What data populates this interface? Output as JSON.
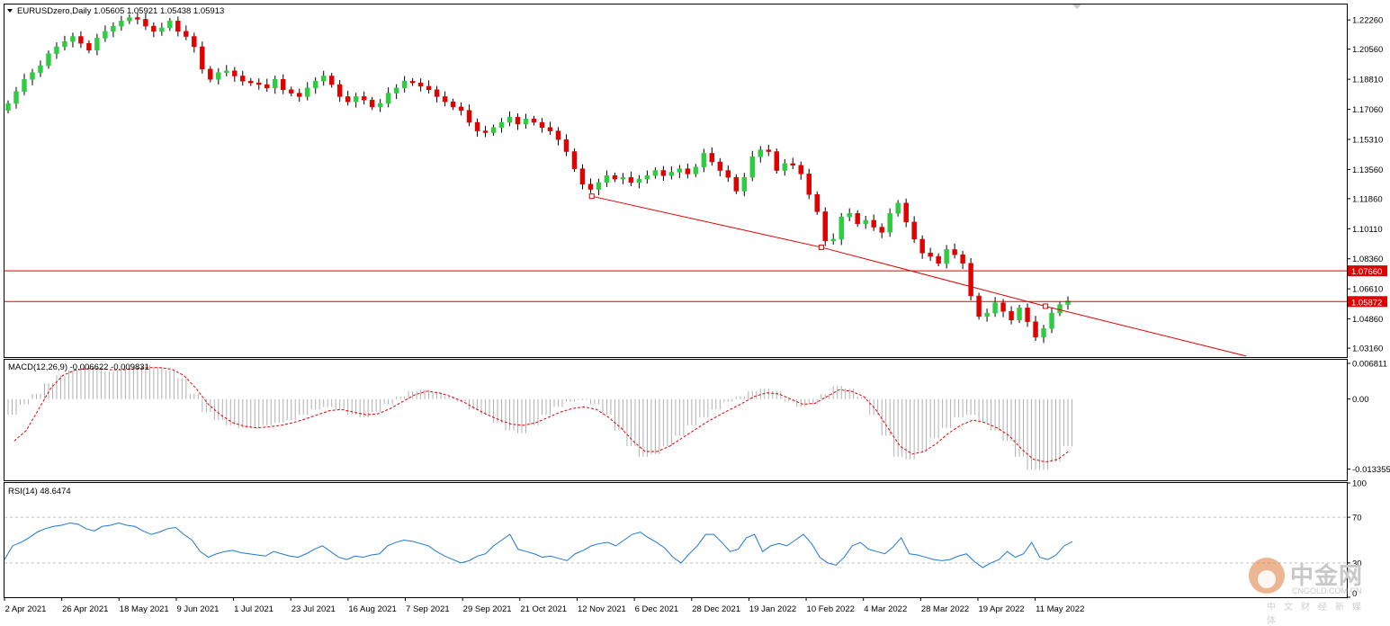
{
  "header": {
    "symbol_line": "EURUSDzero,Daily  1.05605 1.05921 1.05438 1.05913"
  },
  "colors": {
    "bull": "#2ecc40",
    "bear": "#e00000",
    "line": "#e00000",
    "rsi": "#1f77d0",
    "macd_hist": "#b0b0b0",
    "macd_signal": "#e00000",
    "grid": "#c0c0c0"
  },
  "chart_data": [
    {
      "type": "candlestick",
      "title": "EURUSDzero,Daily",
      "ohlc_label": "1.05605 1.05921 1.05438 1.05913",
      "ylim": [
        1.0264,
        1.2316
      ],
      "y_ticks": [
        "1.22260",
        "1.20560",
        "1.18810",
        "1.17060",
        "1.15310",
        "1.13560",
        "1.11860",
        "1.10110",
        "1.08360",
        "1.06610",
        "1.04860",
        "1.03160"
      ],
      "y_tick_values": [
        1.2226,
        1.2056,
        1.1881,
        1.1706,
        1.1531,
        1.1356,
        1.1186,
        1.1011,
        1.0836,
        1.0661,
        1.0486,
        1.0316
      ],
      "x_ticks": [
        "2 Apr 2021",
        "26 Apr 2021",
        "18 May 2021",
        "9 Jun 2021",
        "1 Jul 2021",
        "23 Jul 2021",
        "16 Aug 2021",
        "7 Sep 2021",
        "29 Sep 2021",
        "21 Oct 2021",
        "12 Nov 2021",
        "6 Dec 2021",
        "28 Dec 2021",
        "19 Jan 2022",
        "10 Feb 2022",
        "4 Mar 2022",
        "28 Mar 2022",
        "19 Apr 2022",
        "11 May 2022"
      ],
      "close_path": [
        1.174,
        1.181,
        1.188,
        1.192,
        1.196,
        1.203,
        1.207,
        1.21,
        1.213,
        1.209,
        1.205,
        1.212,
        1.216,
        1.219,
        1.222,
        1.224,
        1.223,
        1.219,
        1.216,
        1.218,
        1.222,
        1.216,
        1.213,
        1.207,
        1.194,
        1.188,
        1.192,
        1.193,
        1.19,
        1.187,
        1.186,
        1.185,
        1.183,
        1.188,
        1.182,
        1.18,
        1.178,
        1.183,
        1.187,
        1.19,
        1.185,
        1.178,
        1.175,
        1.178,
        1.176,
        1.172,
        1.174,
        1.18,
        1.183,
        1.187,
        1.186,
        1.184,
        1.182,
        1.178,
        1.175,
        1.172,
        1.17,
        1.163,
        1.158,
        1.157,
        1.16,
        1.163,
        1.166,
        1.162,
        1.165,
        1.163,
        1.16,
        1.158,
        1.153,
        1.146,
        1.136,
        1.127,
        1.124,
        1.128,
        1.132,
        1.13,
        1.131,
        1.128,
        1.13,
        1.132,
        1.135,
        1.132,
        1.134,
        1.136,
        1.133,
        1.137,
        1.145,
        1.14,
        1.135,
        1.131,
        1.123,
        1.131,
        1.143,
        1.147,
        1.146,
        1.135,
        1.139,
        1.138,
        1.133,
        1.121,
        1.111,
        1.094,
        1.095,
        1.108,
        1.11,
        1.104,
        1.106,
        1.102,
        1.099,
        1.11,
        1.116,
        1.105,
        1.095,
        1.087,
        1.085,
        1.081,
        1.089,
        1.086,
        1.081,
        1.062,
        1.05,
        1.052,
        1.058,
        1.053,
        1.048,
        1.055,
        1.047,
        1.038,
        1.043,
        1.052,
        1.057,
        1.0591
      ],
      "trendline": [
        [
          0.4375,
          1.12
        ],
        [
          0.6085,
          1.0903
        ],
        [
          0.7755,
          1.056
        ],
        [
          0.925,
          1.027
        ]
      ],
      "hlines": [
        {
          "value": 1.0766,
          "label": "1.07660"
        },
        {
          "value": 1.05872,
          "label": "1.05872"
        }
      ]
    },
    {
      "type": "bar",
      "title": "MACD(12,26,9) -0.006622 -0.009831",
      "ylim": [
        -0.0155,
        0.0075
      ],
      "y_ticks": [
        "0.006811",
        "0.00",
        "-0.013355"
      ],
      "y_tick_values": [
        0.006811,
        0.0,
        -0.013355
      ],
      "histogram": [
        -0.003,
        -0.001,
        0.001,
        0.003,
        0.0045,
        0.0055,
        0.006,
        0.0058,
        0.0052,
        0.0055,
        0.0062,
        0.0065,
        0.0062,
        0.0055,
        0.004,
        0.001,
        -0.0025,
        -0.004,
        -0.005,
        -0.0055,
        -0.0055,
        -0.005,
        -0.0045,
        -0.004,
        -0.003,
        -0.002,
        -0.0015,
        -0.002,
        -0.003,
        -0.0035,
        -0.0025,
        -0.001,
        0.0005,
        0.0015,
        0.0018,
        0.0012,
        0.0005,
        -0.0005,
        -0.002,
        -0.003,
        -0.0045,
        -0.006,
        -0.0065,
        -0.005,
        -0.003,
        -0.0015,
        -0.0005,
        -0.0002,
        -0.001,
        -0.003,
        -0.006,
        -0.009,
        -0.011,
        -0.0105,
        -0.009,
        -0.007,
        -0.005,
        -0.0035,
        -0.002,
        -0.0005,
        0.0005,
        0.0015,
        0.002,
        0.0015,
        -0.0005,
        -0.0015,
        -0.001,
        0.001,
        0.0025,
        0.002,
        0.0005,
        -0.003,
        -0.007,
        -0.011,
        -0.0115,
        -0.01,
        -0.0075,
        -0.0055,
        -0.0035,
        -0.003,
        -0.0045,
        -0.006,
        -0.008,
        -0.011,
        -0.0135,
        -0.0135,
        -0.012,
        -0.009
      ],
      "signal": [
        -0.008,
        -0.006,
        -0.002,
        0.002,
        0.0045,
        0.0055,
        0.0058,
        0.0058,
        0.0056,
        0.0056,
        0.0058,
        0.006,
        0.006,
        0.0057,
        0.0045,
        0.002,
        -0.001,
        -0.003,
        -0.0045,
        -0.0052,
        -0.0055,
        -0.0053,
        -0.005,
        -0.0045,
        -0.0038,
        -0.003,
        -0.0022,
        -0.002,
        -0.0025,
        -0.003,
        -0.0028,
        -0.0018,
        -0.0005,
        0.0008,
        0.0015,
        0.0012,
        0.0005,
        -0.0005,
        -0.0018,
        -0.003,
        -0.004,
        -0.0048,
        -0.005,
        -0.0045,
        -0.0035,
        -0.0025,
        -0.0018,
        -0.0015,
        -0.002,
        -0.0035,
        -0.0055,
        -0.008,
        -0.01,
        -0.01,
        -0.009,
        -0.0075,
        -0.006,
        -0.0045,
        -0.0032,
        -0.002,
        -0.0008,
        0.0005,
        0.0012,
        0.001,
        0.0,
        -0.001,
        -0.0008,
        0.0005,
        0.0018,
        0.0015,
        0.0005,
        -0.002,
        -0.0055,
        -0.009,
        -0.0105,
        -0.01,
        -0.0085,
        -0.0065,
        -0.005,
        -0.004,
        -0.0045,
        -0.0055,
        -0.007,
        -0.0095,
        -0.0115,
        -0.012,
        -0.0115,
        -0.0098
      ]
    },
    {
      "type": "line",
      "title": "RSI(14) 48.6474",
      "ylim": [
        0,
        100
      ],
      "y_ticks": [
        "100",
        "70",
        "30",
        "0"
      ],
      "y_tick_values": [
        100,
        70,
        30,
        0
      ],
      "levels": [
        70,
        30
      ],
      "values": [
        33,
        45,
        48,
        52,
        57,
        60,
        62,
        63,
        65,
        64,
        60,
        58,
        62,
        63,
        65,
        63,
        62,
        58,
        55,
        57,
        60,
        61,
        55,
        50,
        40,
        35,
        38,
        40,
        41,
        39,
        38,
        37,
        36,
        40,
        38,
        36,
        35,
        38,
        42,
        45,
        40,
        35,
        33,
        36,
        35,
        37,
        38,
        45,
        48,
        50,
        49,
        47,
        45,
        40,
        36,
        33,
        30,
        32,
        36,
        38,
        45,
        50,
        55,
        42,
        40,
        38,
        35,
        36,
        34,
        32,
        38,
        41,
        45,
        47,
        48,
        45,
        50,
        55,
        57,
        52,
        48,
        43,
        35,
        30,
        38,
        45,
        55,
        55,
        48,
        40,
        42,
        52,
        55,
        40,
        45,
        47,
        45,
        50,
        55,
        47,
        35,
        30,
        28,
        35,
        45,
        48,
        42,
        40,
        38,
        44,
        52,
        38,
        37,
        35,
        33,
        32,
        33,
        36,
        38,
        31,
        26,
        30,
        33,
        40,
        35,
        38,
        48,
        35,
        33,
        37,
        45,
        48.6474
      ]
    }
  ]
}
